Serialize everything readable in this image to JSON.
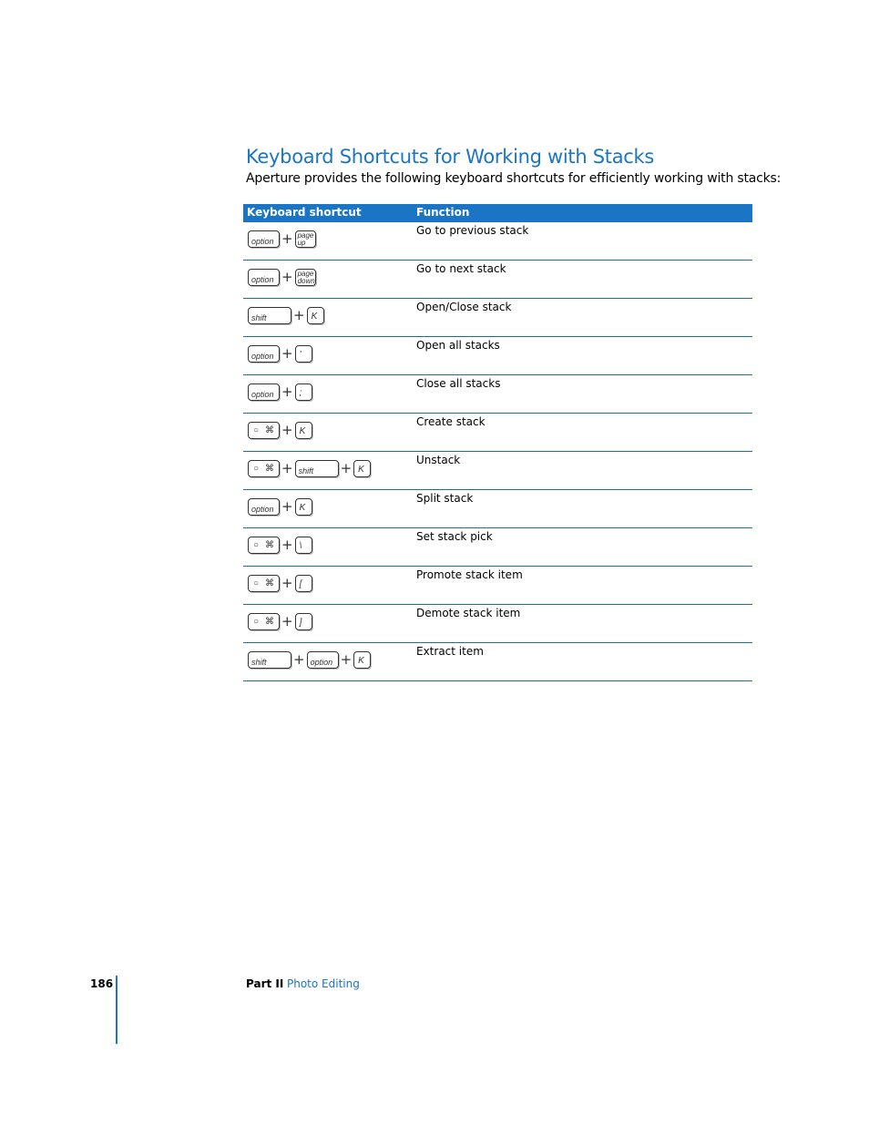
{
  "heading": "Keyboard Shortcuts for Working with Stacks",
  "intro": "Aperture provides the following keyboard shortcuts for efficiently working with stacks:",
  "table": {
    "headers": [
      "Keyboard shortcut",
      "Function"
    ],
    "rows": [
      {
        "keys": [
          {
            "label": "option",
            "type": "wide"
          },
          {
            "label": "page|up",
            "type": "two"
          }
        ],
        "function": "Go to previous stack"
      },
      {
        "keys": [
          {
            "label": "option",
            "type": "wide"
          },
          {
            "label": "page|down",
            "type": "two"
          }
        ],
        "function": "Go to next stack"
      },
      {
        "keys": [
          {
            "label": "shift",
            "type": "xwide"
          },
          {
            "label": "K",
            "type": "small"
          }
        ],
        "function": "Open/Close stack"
      },
      {
        "keys": [
          {
            "label": "option",
            "type": "wide"
          },
          {
            "label": "'",
            "type": "small"
          }
        ],
        "function": "Open all stacks"
      },
      {
        "keys": [
          {
            "label": "option",
            "type": "wide"
          },
          {
            "label": ";",
            "type": "small"
          }
        ],
        "function": "Close all stacks"
      },
      {
        "keys": [
          {
            "label": "command",
            "type": "cmd"
          },
          {
            "label": "K",
            "type": "small"
          }
        ],
        "function": "Create stack"
      },
      {
        "keys": [
          {
            "label": "command",
            "type": "cmd"
          },
          {
            "label": "shift",
            "type": "xwide"
          },
          {
            "label": "K",
            "type": "small"
          }
        ],
        "function": "Unstack"
      },
      {
        "keys": [
          {
            "label": "option",
            "type": "wide"
          },
          {
            "label": "K",
            "type": "small"
          }
        ],
        "function": "Split stack"
      },
      {
        "keys": [
          {
            "label": "command",
            "type": "cmd"
          },
          {
            "label": "\\",
            "type": "small"
          }
        ],
        "function": "Set stack pick"
      },
      {
        "keys": [
          {
            "label": "command",
            "type": "cmd"
          },
          {
            "label": "[",
            "type": "small"
          }
        ],
        "function": "Promote stack item"
      },
      {
        "keys": [
          {
            "label": "command",
            "type": "cmd"
          },
          {
            "label": "]",
            "type": "small"
          }
        ],
        "function": "Demote stack item"
      },
      {
        "keys": [
          {
            "label": "shift",
            "type": "xwide"
          },
          {
            "label": "option",
            "type": "wide"
          },
          {
            "label": "K",
            "type": "small"
          }
        ],
        "function": "Extract item"
      }
    ]
  },
  "command_key_glyphs": {
    "apple": "",
    "cmd": "⌘"
  },
  "plus_sign": "+",
  "footer": {
    "page_number": "186",
    "part": "Part II",
    "section": "Photo Editing"
  }
}
